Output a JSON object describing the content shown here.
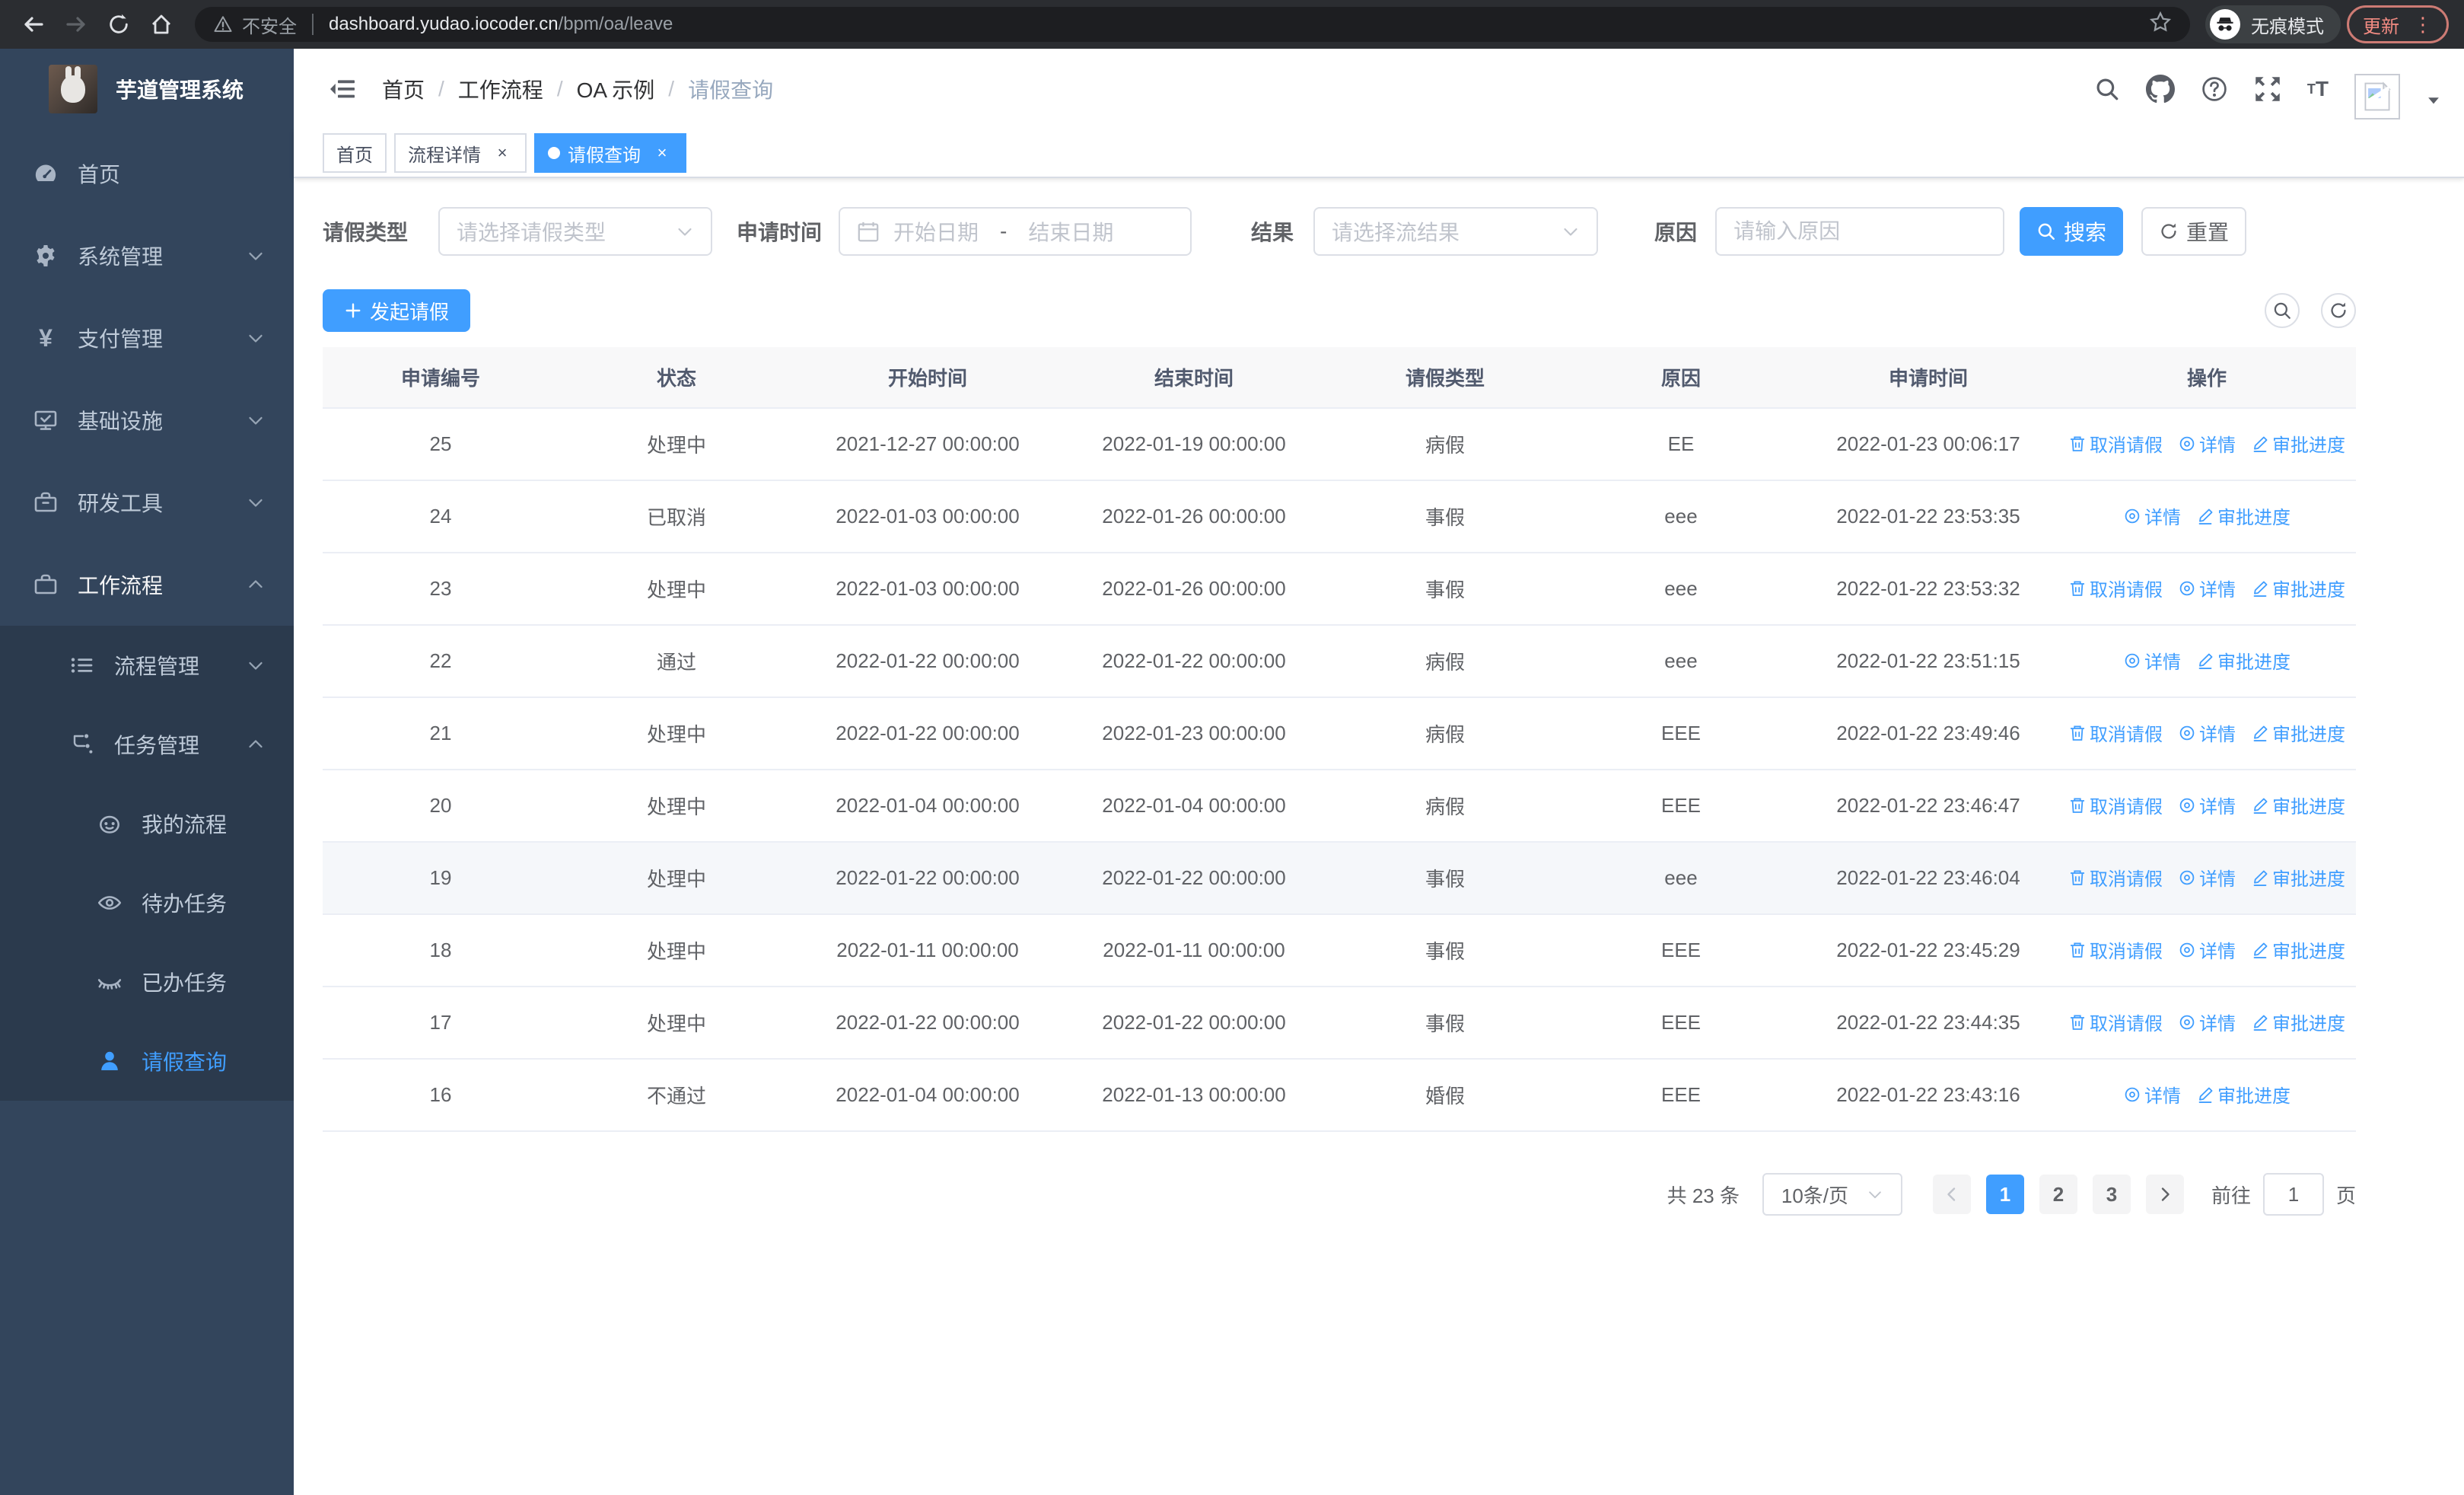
{
  "browser": {
    "security_label": "不安全",
    "url_host": "dashboard.yudao.iocoder.cn",
    "url_path": "/bpm/oa/leave",
    "incognito_label": "无痕模式",
    "update_label": "更新"
  },
  "sidebar": {
    "title": "芋道管理系统",
    "items": [
      {
        "label": "首页",
        "icon": "dashboard",
        "level": 1
      },
      {
        "label": "系统管理",
        "icon": "gear",
        "level": 1,
        "chevron": "down"
      },
      {
        "label": "支付管理",
        "icon": "yen",
        "level": 1,
        "chevron": "down"
      },
      {
        "label": "基础设施",
        "icon": "monitor",
        "level": 1,
        "chevron": "down"
      },
      {
        "label": "研发工具",
        "icon": "toolbox",
        "level": 1,
        "chevron": "down"
      },
      {
        "label": "工作流程",
        "icon": "briefcase",
        "level": 1,
        "chevron": "up",
        "open": true
      },
      {
        "label": "流程管理",
        "icon": "list",
        "level": 2,
        "sub": true,
        "chevron": "down"
      },
      {
        "label": "任务管理",
        "icon": "flow",
        "level": 2,
        "sub": true,
        "chevron": "up"
      },
      {
        "label": "我的流程",
        "icon": "face",
        "level": 3,
        "sub": true
      },
      {
        "label": "待办任务",
        "icon": "eye-open",
        "level": 3,
        "sub": true
      },
      {
        "label": "已办任务",
        "icon": "eye-closed",
        "level": 3,
        "sub": true
      },
      {
        "label": "请假查询",
        "icon": "user",
        "level": 3,
        "sub": true,
        "active": true
      }
    ]
  },
  "header": {
    "breadcrumb": [
      "首页",
      "工作流程",
      "OA 示例",
      "请假查询"
    ],
    "separator": "/"
  },
  "tabs": [
    {
      "label": "首页",
      "closable": false,
      "active": false
    },
    {
      "label": "流程详情",
      "closable": true,
      "active": false
    },
    {
      "label": "请假查询",
      "closable": true,
      "active": true
    }
  ],
  "filters": {
    "leave_type": {
      "label": "请假类型",
      "placeholder": "请选择请假类型"
    },
    "apply_time": {
      "label": "申请时间",
      "start_placeholder": "开始日期",
      "separator": "-",
      "end_placeholder": "结束日期"
    },
    "result": {
      "label": "结果",
      "placeholder": "请选择流结果"
    },
    "reason": {
      "label": "原因",
      "placeholder": "请输入原因"
    },
    "search_label": "搜索",
    "reset_label": "重置"
  },
  "toolbar": {
    "create_label": "发起请假"
  },
  "table": {
    "headers": [
      "申请编号",
      "状态",
      "开始时间",
      "结束时间",
      "请假类型",
      "原因",
      "申请时间",
      "操作"
    ],
    "action_labels": {
      "cancel": "取消请假",
      "detail": "详情",
      "progress": "审批进度"
    },
    "rows": [
      {
        "id": "25",
        "status": "处理中",
        "start": "2021-12-27 00:00:00",
        "end": "2022-01-19 00:00:00",
        "type": "病假",
        "reason": "EE",
        "apply_time": "2022-01-23 00:06:17",
        "actions": [
          "cancel",
          "detail",
          "progress"
        ],
        "highlight": false
      },
      {
        "id": "24",
        "status": "已取消",
        "start": "2022-01-03 00:00:00",
        "end": "2022-01-26 00:00:00",
        "type": "事假",
        "reason": "eee",
        "apply_time": "2022-01-22 23:53:35",
        "actions": [
          "detail",
          "progress"
        ],
        "highlight": false
      },
      {
        "id": "23",
        "status": "处理中",
        "start": "2022-01-03 00:00:00",
        "end": "2022-01-26 00:00:00",
        "type": "事假",
        "reason": "eee",
        "apply_time": "2022-01-22 23:53:32",
        "actions": [
          "cancel",
          "detail",
          "progress"
        ],
        "highlight": false
      },
      {
        "id": "22",
        "status": "通过",
        "start": "2022-01-22 00:00:00",
        "end": "2022-01-22 00:00:00",
        "type": "病假",
        "reason": "eee",
        "apply_time": "2022-01-22 23:51:15",
        "actions": [
          "detail",
          "progress"
        ],
        "highlight": false
      },
      {
        "id": "21",
        "status": "处理中",
        "start": "2022-01-22 00:00:00",
        "end": "2022-01-23 00:00:00",
        "type": "病假",
        "reason": "EEE",
        "apply_time": "2022-01-22 23:49:46",
        "actions": [
          "cancel",
          "detail",
          "progress"
        ],
        "highlight": false
      },
      {
        "id": "20",
        "status": "处理中",
        "start": "2022-01-04 00:00:00",
        "end": "2022-01-04 00:00:00",
        "type": "病假",
        "reason": "EEE",
        "apply_time": "2022-01-22 23:46:47",
        "actions": [
          "cancel",
          "detail",
          "progress"
        ],
        "highlight": false
      },
      {
        "id": "19",
        "status": "处理中",
        "start": "2022-01-22 00:00:00",
        "end": "2022-01-22 00:00:00",
        "type": "事假",
        "reason": "eee",
        "apply_time": "2022-01-22 23:46:04",
        "actions": [
          "cancel",
          "detail",
          "progress"
        ],
        "highlight": true
      },
      {
        "id": "18",
        "status": "处理中",
        "start": "2022-01-11 00:00:00",
        "end": "2022-01-11 00:00:00",
        "type": "事假",
        "reason": "EEE",
        "apply_time": "2022-01-22 23:45:29",
        "actions": [
          "cancel",
          "detail",
          "progress"
        ],
        "highlight": false
      },
      {
        "id": "17",
        "status": "处理中",
        "start": "2022-01-22 00:00:00",
        "end": "2022-01-22 00:00:00",
        "type": "事假",
        "reason": "EEE",
        "apply_time": "2022-01-22 23:44:35",
        "actions": [
          "cancel",
          "detail",
          "progress"
        ],
        "highlight": false
      },
      {
        "id": "16",
        "status": "不通过",
        "start": "2022-01-04 00:00:00",
        "end": "2022-01-13 00:00:00",
        "type": "婚假",
        "reason": "EEE",
        "apply_time": "2022-01-22 23:43:16",
        "actions": [
          "detail",
          "progress"
        ],
        "highlight": false
      }
    ]
  },
  "pagination": {
    "total_text": "共 23 条",
    "page_size": "10条/页",
    "pages": [
      "1",
      "2",
      "3"
    ],
    "active_page": "1",
    "goto_label": "前往",
    "goto_value": "1",
    "page_unit": "页"
  },
  "colors": {
    "accent": "#409eff",
    "sidebar_bg": "#33455c",
    "submenu_bg": "#2b3a4d",
    "update_red": "#f28b82"
  }
}
